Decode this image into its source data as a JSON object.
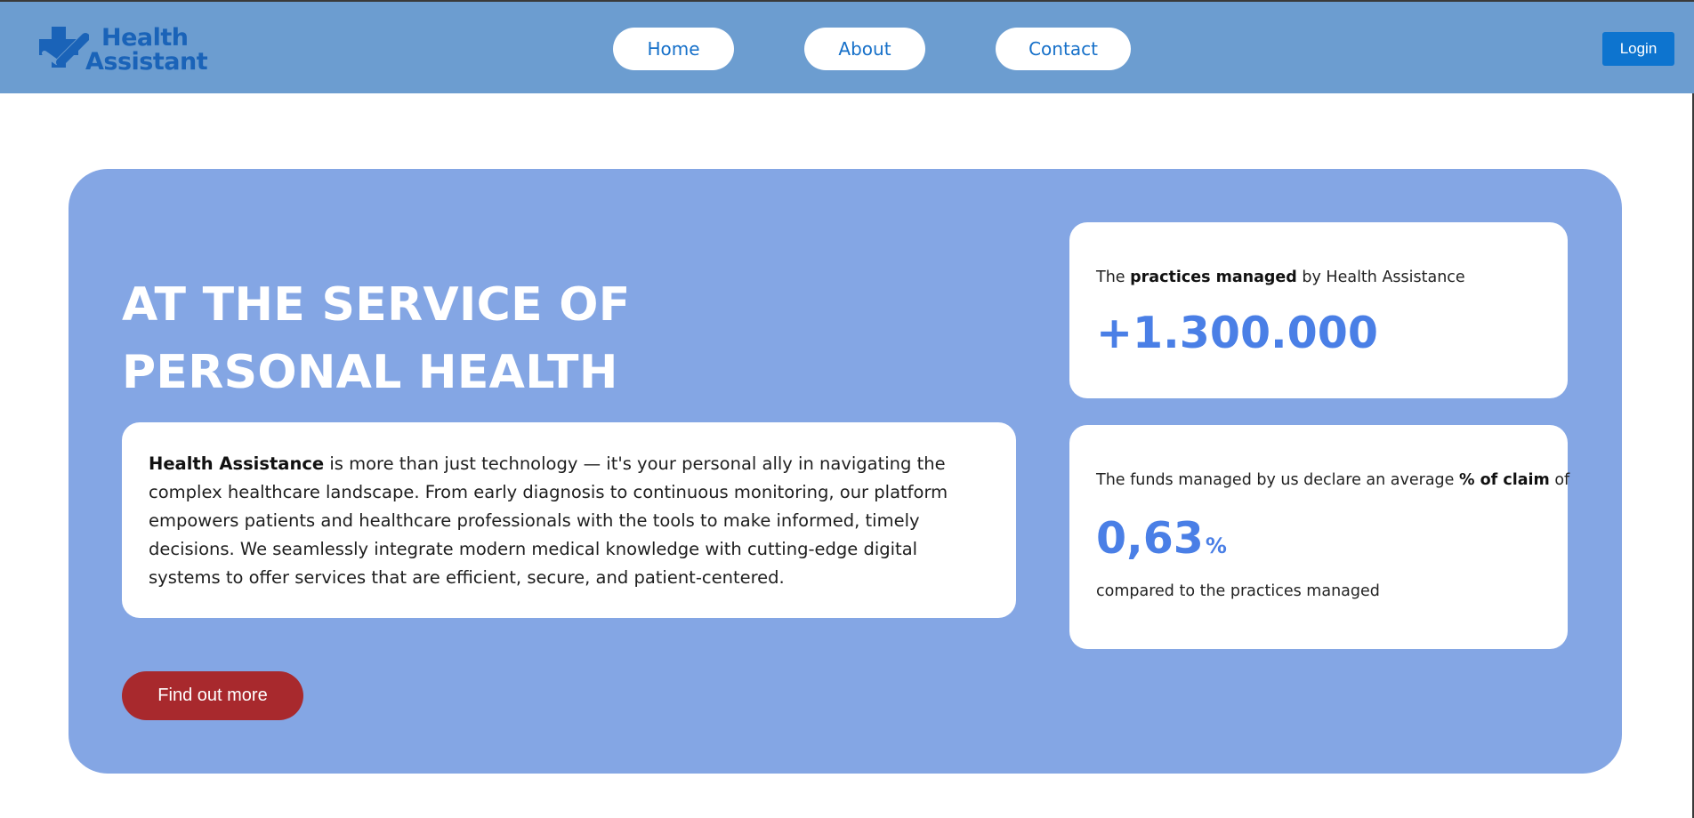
{
  "header": {
    "logo": {
      "line1": "Health",
      "line2": "Assistant"
    },
    "nav": [
      {
        "label": "Home"
      },
      {
        "label": "About"
      },
      {
        "label": "Contact"
      }
    ],
    "login_label": "Login"
  },
  "hero": {
    "title_line1": "AT THE SERVICE OF",
    "title_line2": "PERSONAL HEALTH",
    "description": {
      "brand": "Health Assistance",
      "text": " is more than just technology — it's your personal ally in navigating the complex healthcare landscape. From early diagnosis to continuous monitoring, our platform empowers patients and healthcare professionals with the tools to make informed, timely decisions. We seamlessly integrate modern medical knowledge with cutting-edge digital systems to offer services that are efficient, secure, and patient-centered."
    },
    "cta_label": "Find out more"
  },
  "stats": {
    "practices": {
      "label_pre": "The ",
      "label_bold": "practices managed",
      "label_post": " by Health Assistance",
      "value": "+1.300.000"
    },
    "claim": {
      "label_pre": "The funds managed by us declare an average ",
      "label_bold": "% of claim",
      "label_post": " of",
      "value": "0,63",
      "unit": "%",
      "footnote": "compared to the practices managed"
    }
  },
  "colors": {
    "header_bg": "#6c9dd0",
    "hero_bg": "#84a6e4",
    "accent_blue": "#4a7fe6",
    "nav_text": "#1670c9",
    "login_bg": "#0d74cf",
    "cta_bg": "#a8292d",
    "logo_color": "#1a63b8"
  },
  "icons": {
    "logo_mark": "medical-cross-check-icon"
  }
}
